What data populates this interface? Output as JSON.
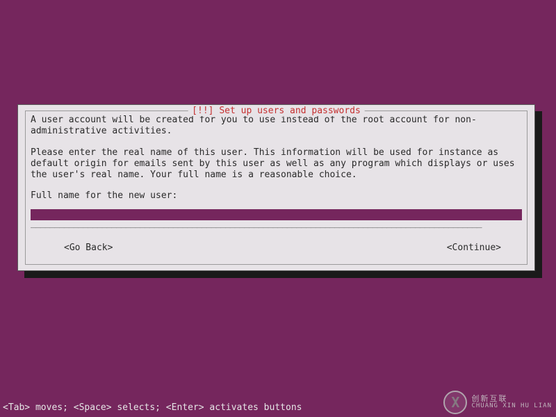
{
  "dialog": {
    "title": "[!!] Set up users and passwords",
    "paragraph1": "A user account will be created for you to use instead of the root account for non-administrative activities.",
    "paragraph2": "Please enter the real name of this user. This information will be used for instance as default origin for emails sent by this user as well as any program which displays or uses the user's real name. Your full name is a reasonable choice.",
    "field_label": "Full name for the new user:",
    "field_value": "",
    "go_back": "<Go Back>",
    "continue": "<Continue>"
  },
  "footer": {
    "hint": "<Tab> moves; <Space> selects; <Enter> activates buttons"
  },
  "watermark": {
    "cn": "创新互联",
    "en": "CHUANG XIN HU LIAN"
  }
}
